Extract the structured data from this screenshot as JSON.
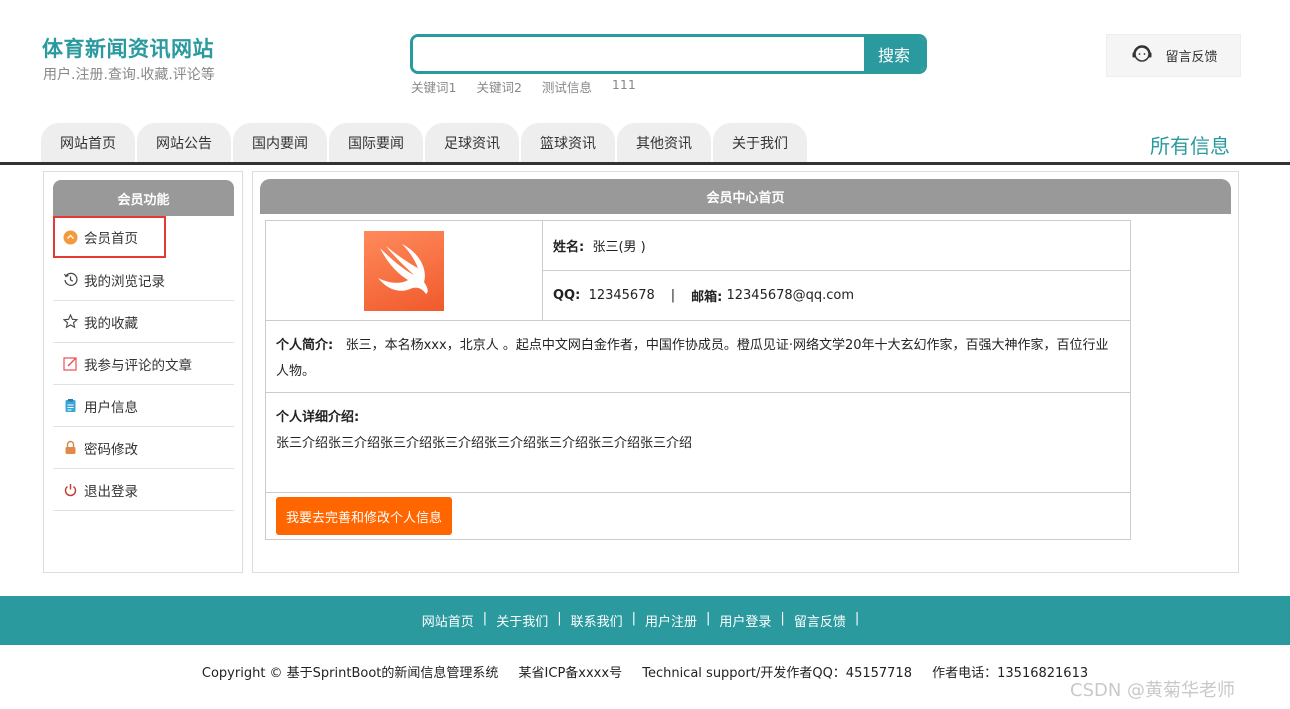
{
  "header": {
    "site_title": "体育新闻资讯网站",
    "site_subtitle": "用户.注册.查询.收藏.评论等",
    "search": {
      "placeholder": "",
      "value": "",
      "button": "搜索"
    },
    "keywords": [
      "关键词1",
      "关键词2",
      "测试信息",
      "111"
    ],
    "feedback": {
      "label": "留言反馈",
      "icon": "customer-service-icon"
    }
  },
  "nav": {
    "tabs": [
      "网站首页",
      "网站公告",
      "国内要闻",
      "国际要闻",
      "足球资讯",
      "篮球资讯",
      "其他资讯",
      "关于我们"
    ],
    "all_info": "所有信息"
  },
  "sidebar": {
    "title": "会员功能",
    "items": [
      {
        "label": "会员首页",
        "icon": "member-home-icon",
        "active": true
      },
      {
        "label": "我的浏览记录",
        "icon": "history-icon"
      },
      {
        "label": "我的收藏",
        "icon": "star-icon"
      },
      {
        "label": "我参与评论的文章",
        "icon": "edit-icon"
      },
      {
        "label": "用户信息",
        "icon": "clipboard-icon"
      },
      {
        "label": "密码修改",
        "icon": "lock-icon"
      },
      {
        "label": "退出登录",
        "icon": "power-icon"
      }
    ]
  },
  "main": {
    "title": "会员中心首页",
    "profile": {
      "name_label": "姓名:",
      "name_value": "张三(男 )",
      "qq_label": "QQ:",
      "qq_value": "12345678",
      "separator": "|",
      "email_label": "邮箱:",
      "email_value": "12345678@qq.com",
      "intro_label": "个人简介:",
      "intro_value": "张三，本名杨xxx，北京人 。起点中文网白金作者，中国作协成员。橙瓜见证·网络文学20年十大玄幻作家，百强大神作家，百位行业人物。",
      "detail_label": "个人详细介绍:",
      "detail_value": "张三介绍张三介绍张三介绍张三介绍张三介绍张三介绍张三介绍张三介绍",
      "edit_button": "我要去完善和修改个人信息"
    }
  },
  "footer": {
    "links": [
      "网站首页",
      "关于我们",
      "联系我们",
      "用户注册",
      "用户登录",
      "留言反馈"
    ],
    "separator": "|",
    "copyright": "Copyright © 基于SprintBoot的新闻信息管理系统",
    "icp": "某省ICP备xxxx号",
    "support": "Technical support/开发作者QQ：45157718",
    "phone": "作者电话：13516821613"
  },
  "watermark": "CSDN @黄菊华老师",
  "colors": {
    "accent": "#2a9a9f",
    "orange": "#ff6600",
    "panel_header": "#999999",
    "highlight": "#e53935"
  }
}
